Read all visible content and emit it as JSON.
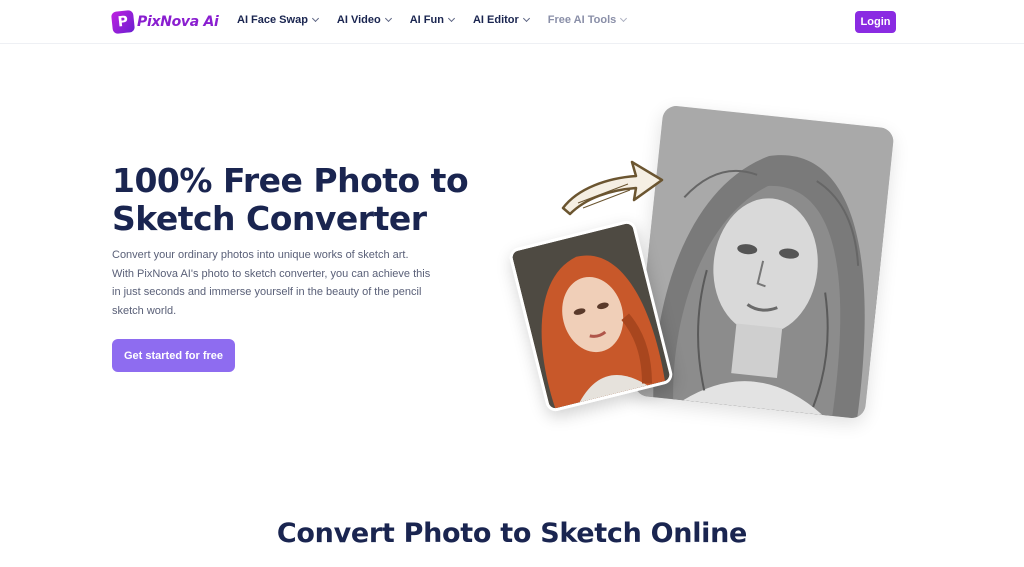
{
  "header": {
    "logo_text": "PixNova Ai",
    "logo_letter": "P",
    "nav": [
      {
        "label": "AI Face Swap"
      },
      {
        "label": "AI Video"
      },
      {
        "label": "AI Fun"
      },
      {
        "label": "AI Editor"
      },
      {
        "label": "Free AI Tools"
      }
    ],
    "login_label": "Login"
  },
  "hero": {
    "title": "100% Free Photo to Sketch Converter",
    "description": "Convert your ordinary photos into unique works of sketch art. With PixNova AI's photo to sketch converter, you can achieve this in just seconds and immerse yourself in the beauty of the pencil sketch world.",
    "cta_label": "Get started for free"
  },
  "section": {
    "title": "Convert Photo to Sketch Online"
  },
  "colors": {
    "brand": "#8a2be2",
    "cta": "#8e6cf0",
    "heading": "#1a2550"
  }
}
